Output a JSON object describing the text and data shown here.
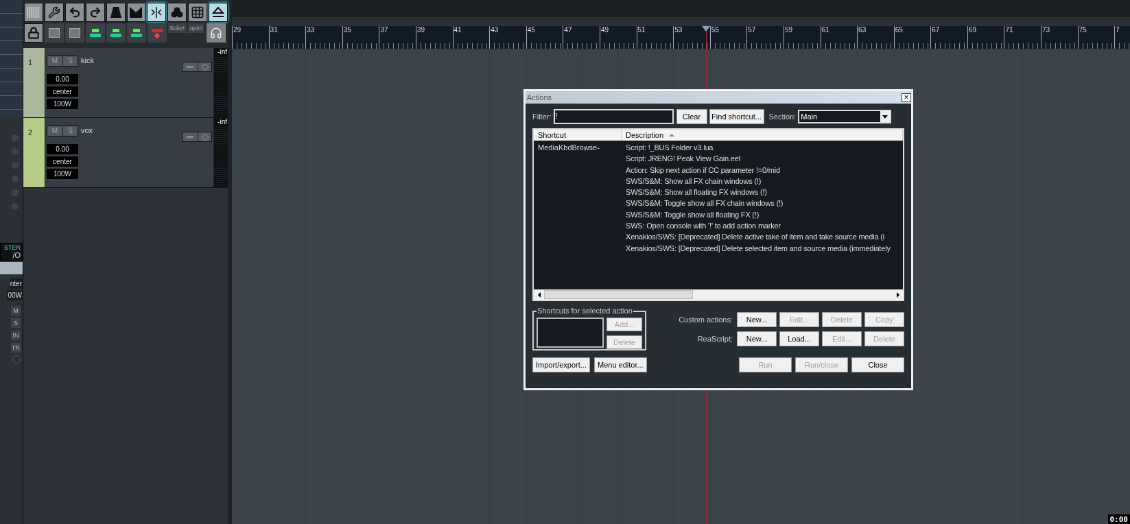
{
  "master_strip": {
    "texts": [
      "STER",
      "/O",
      "nter",
      "00W"
    ],
    "buttons": [
      "M",
      "S",
      "IN",
      "TR"
    ]
  },
  "toolbar": {
    "labels": [
      "Solo+",
      "op/cl"
    ]
  },
  "tracks": [
    {
      "number": "1",
      "name": "kick",
      "mute": "M",
      "solo": "S",
      "volume": "0.00",
      "pan": "center",
      "width": "100W",
      "meter": "-inf",
      "color": "#a9b79d",
      "selected": false
    },
    {
      "number": "2",
      "name": "vox",
      "mute": "M",
      "solo": "S",
      "volume": "0.00",
      "pan": "center",
      "width": "100W",
      "meter": "-inf",
      "color": "#b4cd88",
      "selected": false
    }
  ],
  "ruler": {
    "marks": [
      "29",
      "31",
      "33",
      "35",
      "37",
      "39",
      "41",
      "43",
      "45",
      "47",
      "49",
      "51",
      "53",
      "55",
      "57",
      "59",
      "61",
      "63",
      "65",
      "67",
      "69",
      "71",
      "73",
      "75",
      "7"
    ]
  },
  "actions_dialog": {
    "title": "Actions",
    "close": "×",
    "filter": {
      "label": "Filter:",
      "value": "!"
    },
    "clear_button": "Clear",
    "find_shortcut_button": "Find shortcut...",
    "section": {
      "label": "Section:",
      "value": "Main"
    },
    "columns": [
      {
        "label": "Shortcut",
        "sorted": false
      },
      {
        "label": "Description",
        "sorted": true
      }
    ],
    "rows": [
      {
        "shortcut": "MediaKbdBrowse-",
        "description": "Script: !_BUS Folder v3.lua"
      },
      {
        "description": "Script: JRENG! Peak View Gain.eel"
      },
      {
        "description": "Action: Skip next action if CC parameter !=0/mid"
      },
      {
        "description": "SWS/S&M: Show all FX chain windows (!)"
      },
      {
        "description": "SWS/S&M: Show all floating FX windows (!)"
      },
      {
        "description": "SWS/S&M: Toggle show all FX chain windows (!)"
      },
      {
        "description": "SWS/S&M: Toggle show all floating FX (!)"
      },
      {
        "description": "SWS: Open console with '!' to add action marker"
      },
      {
        "description": "Xenakios/SWS: [Deprecated] Delete active take of item and take source media (i"
      },
      {
        "description": "Xenakios/SWS: [Deprecated] Delete selected item and source media (immediately"
      }
    ],
    "shortcuts_group": {
      "title": "Shortcuts for selected action",
      "buttons": [
        {
          "label": "Add...",
          "disabled": true
        },
        {
          "label": "Delete",
          "disabled": true
        }
      ]
    },
    "custom_actions": {
      "label": "Custom actions:",
      "buttons": [
        {
          "label": "New...",
          "disabled": false
        },
        {
          "label": "Edit...",
          "disabled": true
        },
        {
          "label": "Delete",
          "disabled": true
        },
        {
          "label": "Copy",
          "disabled": true
        }
      ]
    },
    "reascript": {
      "label": "ReaScript:",
      "buttons": [
        {
          "label": "New...",
          "disabled": false
        },
        {
          "label": "Load...",
          "disabled": false
        },
        {
          "label": "Edit...",
          "disabled": true
        },
        {
          "label": "Delete",
          "disabled": true
        }
      ]
    },
    "left_buttons": [
      {
        "label": "Import/export...",
        "disabled": false
      },
      {
        "label": "Menu editor...",
        "disabled": false
      }
    ],
    "right_buttons": [
      {
        "label": "Run",
        "disabled": true
      },
      {
        "label": "Run/close",
        "disabled": true
      },
      {
        "label": "Close",
        "disabled": false
      }
    ]
  },
  "time_display": "0:00"
}
